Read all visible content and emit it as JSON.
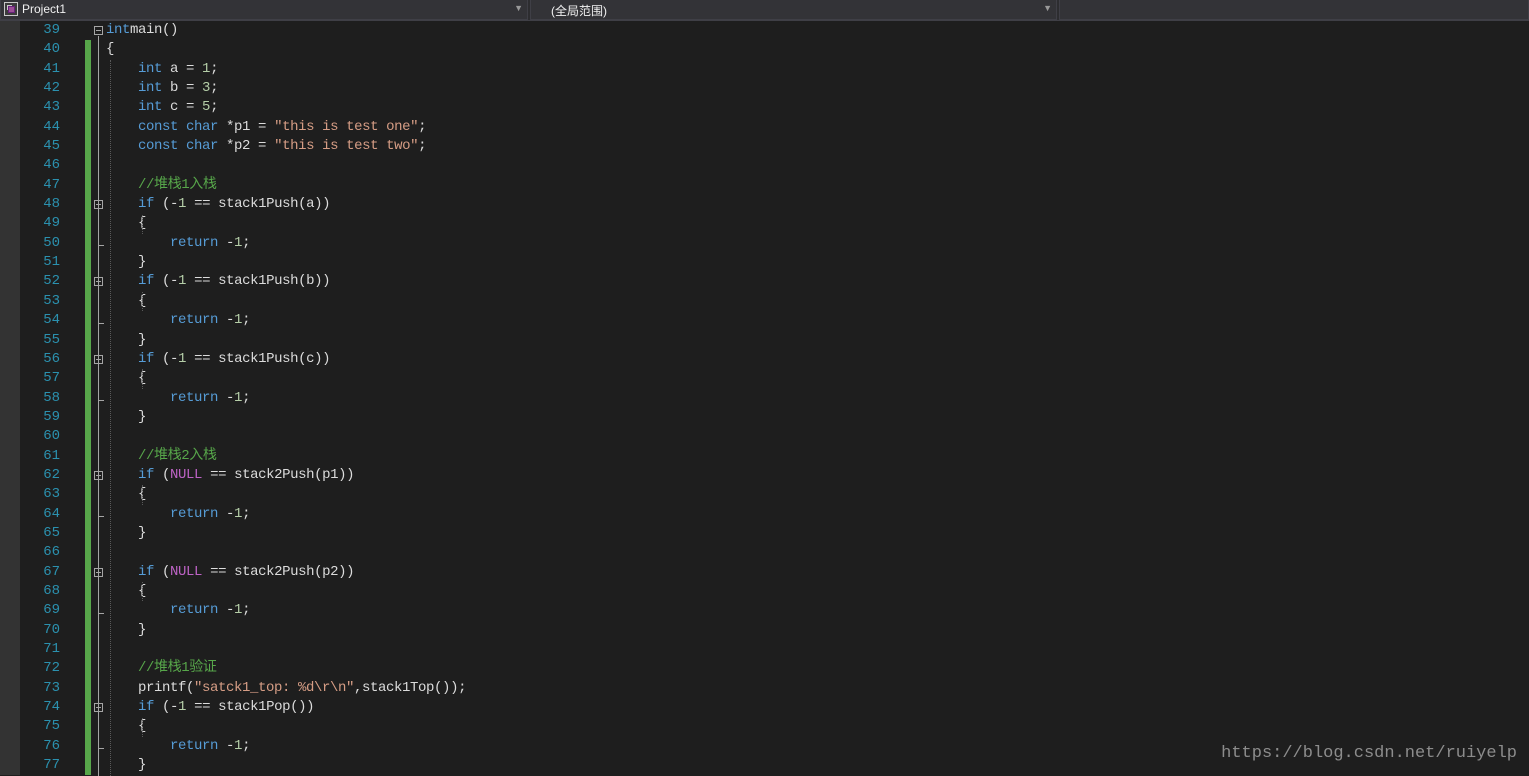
{
  "navbar": {
    "project": "Project1",
    "scope": "(全局范围)"
  },
  "editor": {
    "lines": [
      {
        "n": "39",
        "fold": "open",
        "tokens": [
          [
            "kw",
            "int"
          ],
          [
            "",
            "main()"
          ]
        ]
      },
      {
        "n": "40",
        "tokens": [
          [
            "",
            "{"
          ]
        ]
      },
      {
        "n": "41",
        "tokens": [
          [
            "",
            "    "
          ],
          [
            "kw",
            "int"
          ],
          [
            "",
            " a = "
          ],
          [
            "num",
            "1"
          ],
          [
            "",
            ";"
          ]
        ]
      },
      {
        "n": "42",
        "tokens": [
          [
            "",
            "    "
          ],
          [
            "kw",
            "int"
          ],
          [
            "",
            " b = "
          ],
          [
            "num",
            "3"
          ],
          [
            "",
            ";"
          ]
        ]
      },
      {
        "n": "43",
        "tokens": [
          [
            "",
            "    "
          ],
          [
            "kw",
            "int"
          ],
          [
            "",
            " c = "
          ],
          [
            "num",
            "5"
          ],
          [
            "",
            ";"
          ]
        ]
      },
      {
        "n": "44",
        "tokens": [
          [
            "",
            "    "
          ],
          [
            "kw",
            "const"
          ],
          [
            "",
            ""
          ],
          [
            "kw",
            " char"
          ],
          [
            "",
            " *p1 = "
          ],
          [
            "str",
            "\"this is test one\""
          ],
          [
            "",
            ";"
          ]
        ]
      },
      {
        "n": "45",
        "tokens": [
          [
            "",
            "    "
          ],
          [
            "kw",
            "const"
          ],
          [
            "",
            ""
          ],
          [
            "kw",
            " char"
          ],
          [
            "",
            " *p2 = "
          ],
          [
            "str",
            "\"this is test two\""
          ],
          [
            "",
            ";"
          ]
        ]
      },
      {
        "n": "46",
        "tokens": []
      },
      {
        "n": "47",
        "tokens": [
          [
            "",
            "    "
          ],
          [
            "cm",
            "//堆栈1入栈"
          ]
        ]
      },
      {
        "n": "48",
        "fold": "open",
        "tokens": [
          [
            "",
            "    "
          ],
          [
            "kw",
            "if"
          ],
          [
            "",
            " (-"
          ],
          [
            "num",
            "1"
          ],
          [
            "",
            " == stack1Push(a))"
          ]
        ]
      },
      {
        "n": "49",
        "tokens": [
          [
            "",
            "    {"
          ]
        ]
      },
      {
        "n": "50",
        "tokens": [
          [
            "",
            "        "
          ],
          [
            "kw",
            "return"
          ],
          [
            "",
            " -"
          ],
          [
            "num",
            "1"
          ],
          [
            "",
            ";"
          ]
        ]
      },
      {
        "n": "51",
        "fold": "end",
        "tokens": [
          [
            "",
            "    }"
          ]
        ]
      },
      {
        "n": "52",
        "fold": "open",
        "tokens": [
          [
            "",
            "    "
          ],
          [
            "kw",
            "if"
          ],
          [
            "",
            " (-"
          ],
          [
            "num",
            "1"
          ],
          [
            "",
            " == stack1Push(b))"
          ]
        ]
      },
      {
        "n": "53",
        "tokens": [
          [
            "",
            "    {"
          ]
        ]
      },
      {
        "n": "54",
        "tokens": [
          [
            "",
            "        "
          ],
          [
            "kw",
            "return"
          ],
          [
            "",
            " -"
          ],
          [
            "num",
            "1"
          ],
          [
            "",
            ";"
          ]
        ]
      },
      {
        "n": "55",
        "fold": "end",
        "tokens": [
          [
            "",
            "    }"
          ]
        ]
      },
      {
        "n": "56",
        "fold": "open",
        "tokens": [
          [
            "",
            "    "
          ],
          [
            "kw",
            "if"
          ],
          [
            "",
            " (-"
          ],
          [
            "num",
            "1"
          ],
          [
            "",
            " == stack1Push(c))"
          ]
        ]
      },
      {
        "n": "57",
        "tokens": [
          [
            "",
            "    {"
          ]
        ]
      },
      {
        "n": "58",
        "tokens": [
          [
            "",
            "        "
          ],
          [
            "kw",
            "return"
          ],
          [
            "",
            " -"
          ],
          [
            "num",
            "1"
          ],
          [
            "",
            ";"
          ]
        ]
      },
      {
        "n": "59",
        "fold": "end",
        "tokens": [
          [
            "",
            "    }"
          ]
        ]
      },
      {
        "n": "60",
        "tokens": []
      },
      {
        "n": "61",
        "tokens": [
          [
            "",
            "    "
          ],
          [
            "cm",
            "//堆栈2入栈"
          ]
        ]
      },
      {
        "n": "62",
        "fold": "open",
        "tokens": [
          [
            "",
            "    "
          ],
          [
            "kw",
            "if"
          ],
          [
            "",
            " ("
          ],
          [
            "mac",
            "NULL"
          ],
          [
            "",
            " == stack2Push(p1))"
          ]
        ]
      },
      {
        "n": "63",
        "tokens": [
          [
            "",
            "    {"
          ]
        ]
      },
      {
        "n": "64",
        "tokens": [
          [
            "",
            "        "
          ],
          [
            "kw",
            "return"
          ],
          [
            "",
            " -"
          ],
          [
            "num",
            "1"
          ],
          [
            "",
            ";"
          ]
        ]
      },
      {
        "n": "65",
        "fold": "end",
        "tokens": [
          [
            "",
            "    }"
          ]
        ]
      },
      {
        "n": "66",
        "tokens": []
      },
      {
        "n": "67",
        "fold": "open",
        "tokens": [
          [
            "",
            "    "
          ],
          [
            "kw",
            "if"
          ],
          [
            "",
            " ("
          ],
          [
            "mac",
            "NULL"
          ],
          [
            "",
            " == stack2Push(p2))"
          ]
        ]
      },
      {
        "n": "68",
        "tokens": [
          [
            "",
            "    {"
          ]
        ]
      },
      {
        "n": "69",
        "tokens": [
          [
            "",
            "        "
          ],
          [
            "kw",
            "return"
          ],
          [
            "",
            " -"
          ],
          [
            "num",
            "1"
          ],
          [
            "",
            ";"
          ]
        ]
      },
      {
        "n": "70",
        "fold": "end",
        "tokens": [
          [
            "",
            "    }"
          ]
        ]
      },
      {
        "n": "71",
        "tokens": []
      },
      {
        "n": "72",
        "tokens": [
          [
            "",
            "    "
          ],
          [
            "cm",
            "//堆栈1验证"
          ]
        ]
      },
      {
        "n": "73",
        "tokens": [
          [
            "",
            "    printf("
          ],
          [
            "str",
            "\"satck1_top: %d\\r\\n\""
          ],
          [
            "",
            ",stack1Top());"
          ]
        ]
      },
      {
        "n": "74",
        "fold": "open",
        "tokens": [
          [
            "",
            "    "
          ],
          [
            "kw",
            "if"
          ],
          [
            "",
            " (-"
          ],
          [
            "num",
            "1"
          ],
          [
            "",
            " == stack1Pop())"
          ]
        ]
      },
      {
        "n": "75",
        "tokens": [
          [
            "",
            "    {"
          ]
        ]
      },
      {
        "n": "76",
        "tokens": [
          [
            "",
            "        "
          ],
          [
            "kw",
            "return"
          ],
          [
            "",
            " -"
          ],
          [
            "num",
            "1"
          ],
          [
            "",
            ";"
          ]
        ]
      },
      {
        "n": "77",
        "tokens": [
          [
            "",
            "    }"
          ]
        ]
      }
    ]
  },
  "watermark": "https://blog.csdn.net/ruiyelp",
  "colors": {
    "background": "#1e1e1e",
    "line_number": "#2b91af",
    "keyword": "#569cd6",
    "string": "#d69d85",
    "comment": "#57a64a",
    "macro": "#bd63c5",
    "change_bar": "#57a64a"
  }
}
